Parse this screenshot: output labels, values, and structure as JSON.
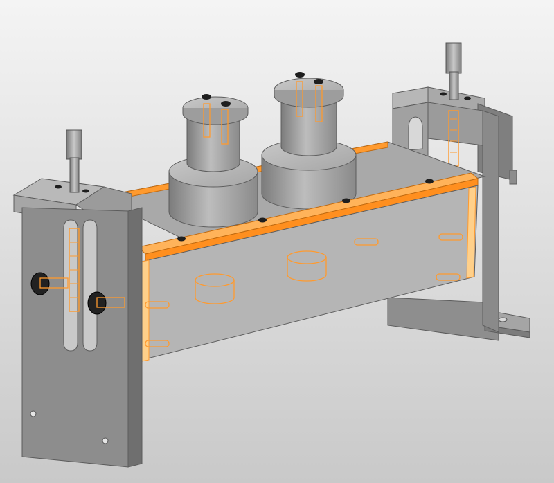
{
  "view": {
    "kind": "cad-3d-assembly",
    "highlight_color": "#ff9a2e",
    "metal_color": "#9a9a9a",
    "fastener_color": "#1e1e1e"
  },
  "assembly": {
    "parts": [
      "left-end-plate",
      "right-end-plate",
      "front-plate",
      "highlighted-rail",
      "left-cylinder-roller",
      "right-cylinder-roller",
      "left-adjustment-screw",
      "right-adjustment-screw",
      "clamping-knobs",
      "base-foot"
    ]
  }
}
